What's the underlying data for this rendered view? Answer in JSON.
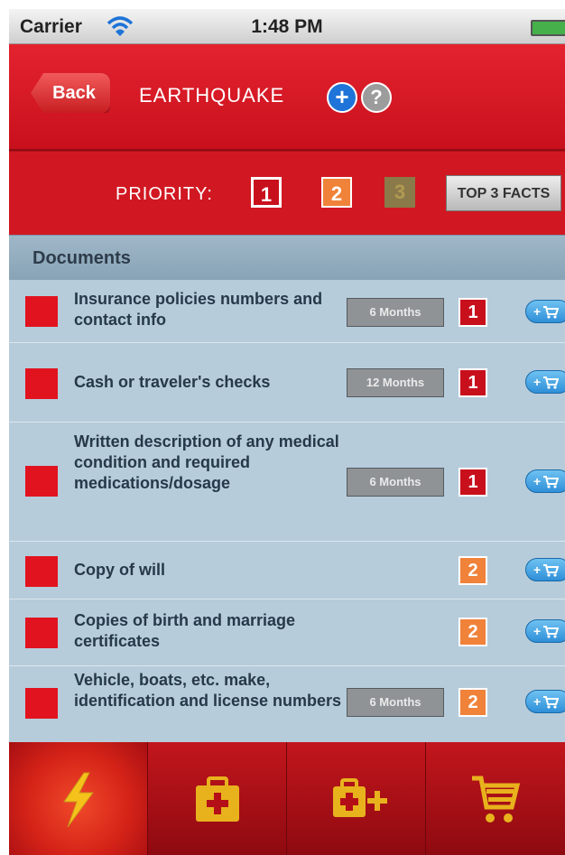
{
  "status_bar": {
    "carrier": "Carrier",
    "time": "1:48 PM"
  },
  "header": {
    "back_label": "Back",
    "title": "EARTHQUAKE",
    "plus": "+",
    "help": "?"
  },
  "priority_bar": {
    "label": "PRIORITY:",
    "p1": "1",
    "p2": "2",
    "p3": "3",
    "facts_label": "TOP 3 FACTS"
  },
  "section": {
    "title": "Documents"
  },
  "items": [
    {
      "text": "Insurance policies numbers and contact info",
      "months": "6 Months",
      "priority": "1"
    },
    {
      "text": "Cash or traveler's checks",
      "months": "12 Months",
      "priority": "1"
    },
    {
      "text": "Written description of any medical condition and required medications/dosage",
      "months": "6 Months",
      "priority": "1"
    },
    {
      "text": "Copy of will",
      "months": "",
      "priority": "2"
    },
    {
      "text": "Copies of birth and marriage certificates",
      "months": "",
      "priority": "2"
    },
    {
      "text": "Vehicle, boats, etc. make, identification and license numbers",
      "months": "6 Months",
      "priority": "2"
    }
  ],
  "tabs": [
    {
      "icon": "lightning-icon",
      "active": true
    },
    {
      "icon": "first-aid-kit-icon",
      "active": false
    },
    {
      "icon": "add-kit-icon",
      "active": false
    },
    {
      "icon": "cart-icon",
      "active": false
    }
  ],
  "colors": {
    "header_red": "#d11822",
    "priority1": "#c8101c",
    "priority2": "#f0823a",
    "list_bg": "#b6ccdb",
    "tab_icon_yellow": "#f5c21b"
  }
}
